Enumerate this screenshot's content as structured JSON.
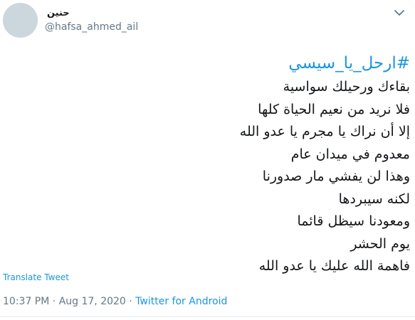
{
  "user": {
    "display_name": "حنين",
    "handle": "@hafsa_ahmed_ail"
  },
  "tweet": {
    "hashtag": "#ارحل_يا_سيسي",
    "lines": [
      "بقاءك ورحيلك سواسية",
      "فلا نريد من نعيم الحياة كلها",
      "إلا أن نراك يا مجرم يا عدو الله",
      "معدوم في ميدان عام",
      "وهذا لن يفشي مار صدورنا",
      "لكنه سيبردها",
      "ومعودنا سيظل قائما",
      "يوم الحشر",
      "فاهمة الله عليك يا عدو الله"
    ]
  },
  "actions": {
    "translate_label": "Translate Tweet"
  },
  "meta": {
    "time": "10:37 PM",
    "separator_1": " · ",
    "date": "Aug 17, 2020",
    "separator_2": " · ",
    "source": "Twitter for Android"
  },
  "icons": {
    "avatar": "avatar-placeholder",
    "menu": "chevron-down-icon"
  },
  "colors": {
    "link": "#1b95e0",
    "text": "#14171a",
    "muted": "#657786",
    "avatar": "#ccd6dd"
  }
}
